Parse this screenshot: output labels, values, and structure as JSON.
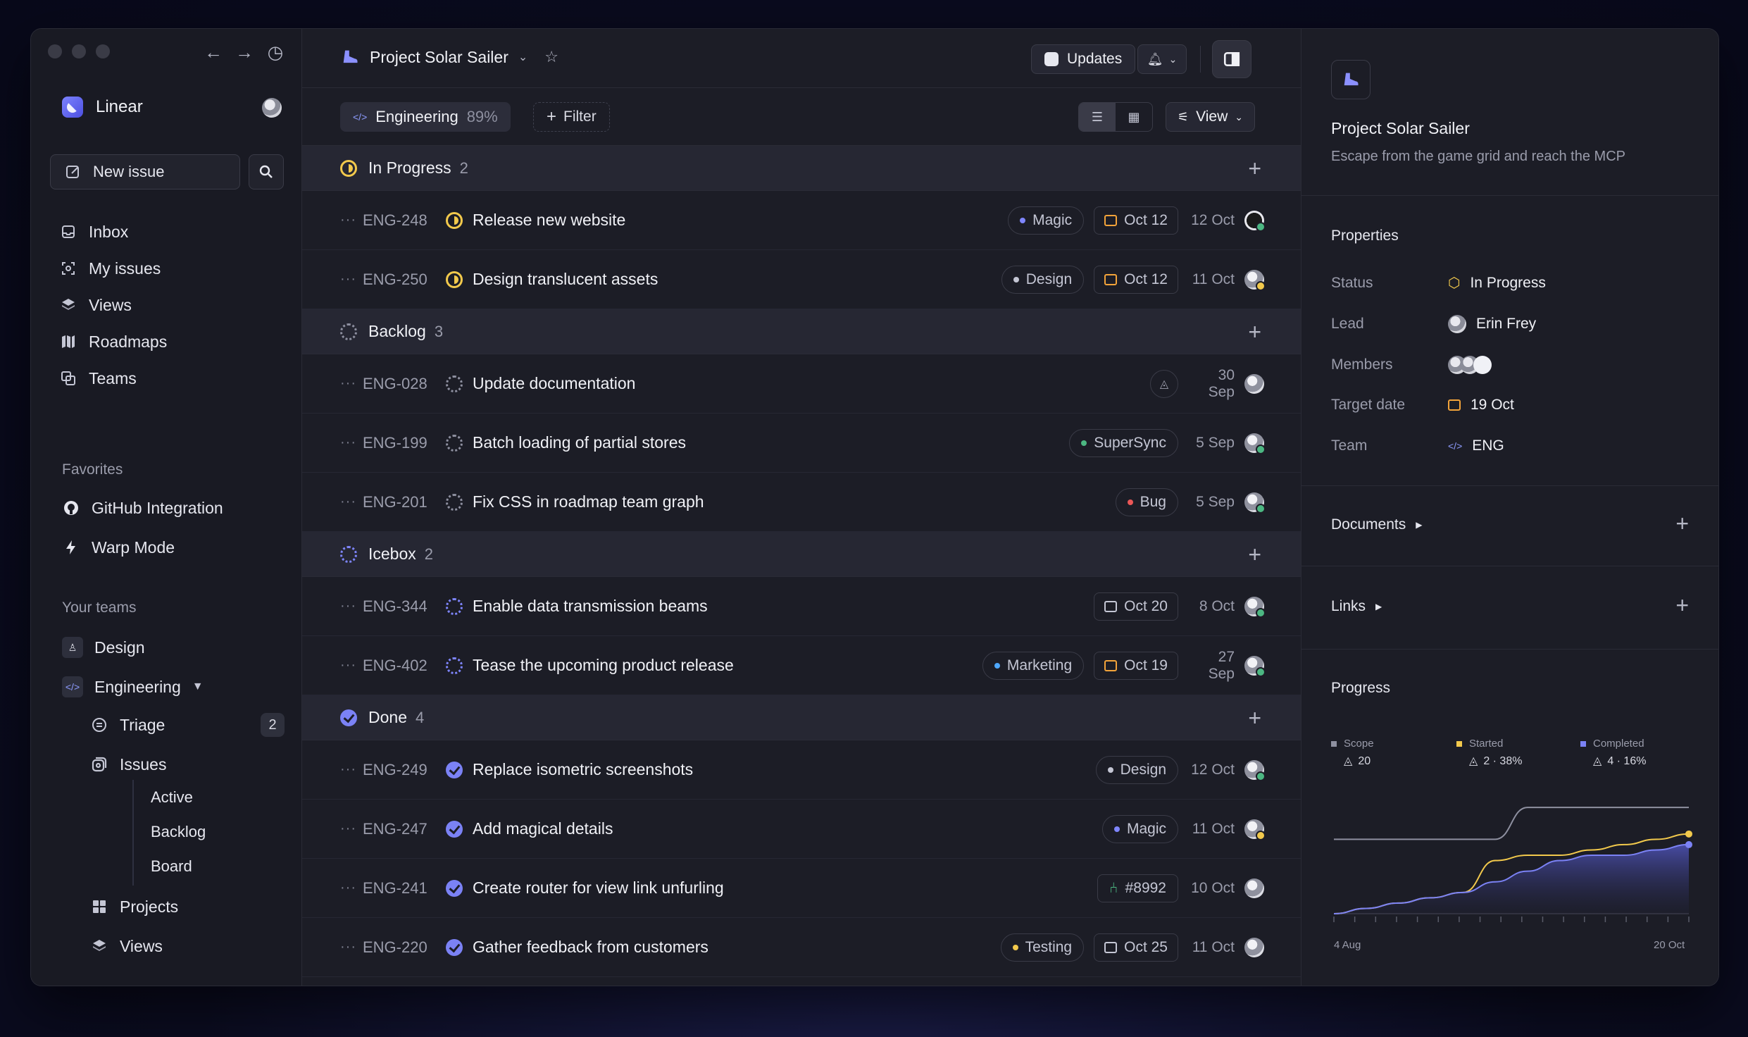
{
  "sidebar": {
    "brand": "Linear",
    "new_issue": "New issue",
    "nav": [
      "Inbox",
      "My issues",
      "Views",
      "Roadmaps",
      "Teams"
    ],
    "favorites_label": "Favorites",
    "favorites": [
      "GitHub Integration",
      "Warp Mode"
    ],
    "teams_label": "Your teams",
    "teams": [
      "Design",
      "Engineering"
    ],
    "eng_items": {
      "triage": "Triage",
      "triage_count": "2",
      "issues": "Issues"
    },
    "issue_views": [
      "Active",
      "Backlog",
      "Board"
    ],
    "projects": "Projects",
    "views": "Views"
  },
  "topbar": {
    "project": "Project Solar Sailer",
    "updates": "Updates"
  },
  "filterbar": {
    "team": "Engineering",
    "team_pct": "89%",
    "filter": "Filter",
    "view": "View"
  },
  "groups": [
    {
      "name": "In Progress",
      "count": "2",
      "status": "progress",
      "rows": [
        {
          "id": "ENG-248",
          "title": "Release new website",
          "label": "Magic",
          "label_color": "#7f86ff",
          "due": "Oct 12",
          "due_color": "#f2a33a",
          "date": "12 Oct",
          "avatar": "dark online"
        },
        {
          "id": "ENG-250",
          "title": "Design translucent assets",
          "label": "Design",
          "label_color": "#c4c6d4",
          "due": "Oct 12",
          "due_color": "#f2a33a",
          "date": "11 Oct",
          "avatar": "away"
        }
      ]
    },
    {
      "name": "Backlog",
      "count": "3",
      "status": "backlog",
      "rows": [
        {
          "id": "ENG-028",
          "title": "Update documentation",
          "estimate": true,
          "date": "30 Sep",
          "avatar": ""
        },
        {
          "id": "ENG-199",
          "title": "Batch loading of partial stores",
          "label": "SuperSync",
          "label_color": "#4cb782",
          "date": "5 Sep",
          "avatar": "online"
        },
        {
          "id": "ENG-201",
          "title": "Fix CSS in roadmap team graph",
          "label": "Bug",
          "label_color": "#eb5757",
          "date": "5 Sep",
          "avatar": "online"
        }
      ]
    },
    {
      "name": "Icebox",
      "count": "2",
      "status": "icebox",
      "rows": [
        {
          "id": "ENG-344",
          "title": "Enable data transmission beams",
          "due": "Oct 20",
          "due_color": "#c4c6d4",
          "date": "8 Oct",
          "avatar": "online"
        },
        {
          "id": "ENG-402",
          "title": "Tease the upcoming product release",
          "label": "Marketing",
          "label_color": "#4ea7fc",
          "due": "Oct 19",
          "due_color": "#f2a33a",
          "date": "27 Sep",
          "avatar": "online"
        }
      ]
    },
    {
      "name": "Done",
      "count": "4",
      "status": "done",
      "rows": [
        {
          "id": "ENG-249",
          "title": "Replace isometric screenshots",
          "label": "Design",
          "label_color": "#c4c6d4",
          "date": "12 Oct",
          "avatar": "online"
        },
        {
          "id": "ENG-247",
          "title": "Add magical details",
          "label": "Magic",
          "label_color": "#7f86ff",
          "date": "11 Oct",
          "avatar": "away"
        },
        {
          "id": "ENG-241",
          "title": "Create router for view link unfurling",
          "pr": "#8992",
          "date": "10 Oct",
          "avatar": ""
        },
        {
          "id": "ENG-220",
          "title": "Gather feedback from customers",
          "label": "Testing",
          "label_color": "#f2c94c",
          "due": "Oct 25",
          "due_color": "#c4c6d4",
          "date": "11 Oct",
          "avatar": ""
        }
      ]
    }
  ],
  "panel": {
    "title": "Project Solar Sailer",
    "subtitle": "Escape from the game grid and reach the MCP",
    "properties_label": "Properties",
    "props": {
      "status_label": "Status",
      "status": "In Progress",
      "lead_label": "Lead",
      "lead": "Erin Frey",
      "members_label": "Members",
      "target_label": "Target date",
      "target": "19 Oct",
      "team_label": "Team",
      "team": "ENG"
    },
    "documents": "Documents",
    "links": "Links",
    "progress": "Progress",
    "legend": [
      {
        "name": "Scope",
        "value": "20",
        "color": "#8e90a0"
      },
      {
        "name": "Started",
        "value": "2 · 38%",
        "color": "#f2c94c"
      },
      {
        "name": "Completed",
        "value": "4 · 16%",
        "color": "#7b82f5"
      }
    ],
    "axis_start": "4 Aug",
    "axis_end": "20 Oct"
  },
  "chart_data": {
    "type": "line",
    "xlabel_start": "4 Aug",
    "xlabel_end": "20 Oct",
    "series": [
      {
        "name": "Scope",
        "values": [
          14,
          14,
          14,
          14,
          14,
          14,
          20,
          20,
          20,
          20,
          20,
          20
        ],
        "color": "#8e90a0"
      },
      {
        "name": "Started",
        "values": [
          0,
          1,
          2,
          3,
          4,
          10,
          11,
          11,
          12,
          13,
          14,
          15
        ],
        "color": "#f2c94c"
      },
      {
        "name": "Completed",
        "values": [
          0,
          1,
          2,
          3,
          4,
          6,
          8,
          10,
          11,
          11,
          12,
          13
        ],
        "color": "#7b82f5"
      }
    ],
    "ylim": [
      0,
      22
    ]
  }
}
